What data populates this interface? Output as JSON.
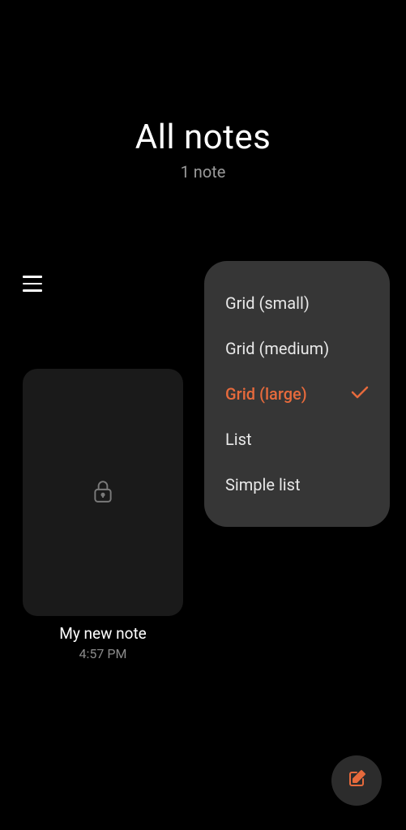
{
  "header": {
    "title": "All notes",
    "subtitle": "1 note"
  },
  "note": {
    "title": "My new note",
    "time": "4:57 PM"
  },
  "viewMenu": {
    "items": [
      {
        "label": "Grid (small)",
        "selected": false
      },
      {
        "label": "Grid (medium)",
        "selected": false
      },
      {
        "label": "Grid (large)",
        "selected": true
      },
      {
        "label": "List",
        "selected": false
      },
      {
        "label": "Simple list",
        "selected": false
      }
    ]
  },
  "colors": {
    "accent": "#e66a3c"
  }
}
